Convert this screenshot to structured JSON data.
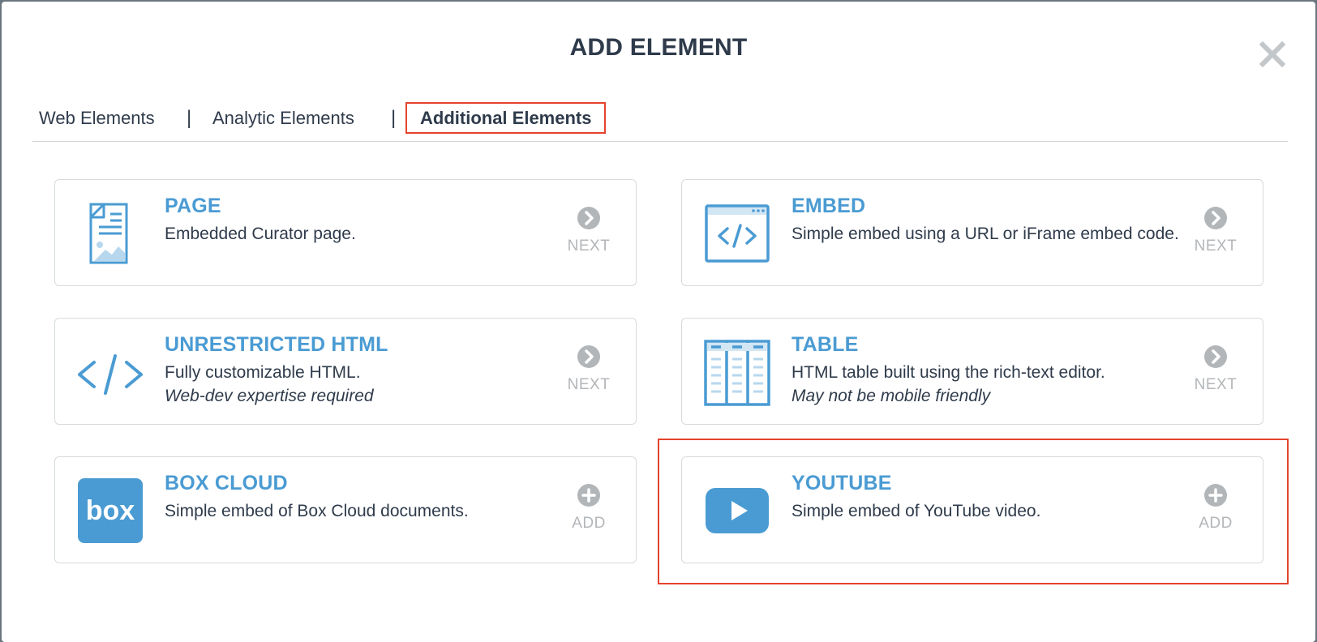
{
  "dialog": {
    "title": "ADD ELEMENT"
  },
  "tabs": [
    {
      "label": "Web Elements",
      "active": false
    },
    {
      "label": "Analytic Elements",
      "active": false
    },
    {
      "label": "Additional Elements",
      "active": true
    }
  ],
  "separator": "|",
  "elements": [
    {
      "name": "PAGE",
      "description": "Embedded Curator page.",
      "note": "",
      "action": "NEXT",
      "icon": "page-icon"
    },
    {
      "name": "EMBED",
      "description": "Simple embed using a URL or iFrame embed code.",
      "note": "",
      "action": "NEXT",
      "icon": "code-window-icon"
    },
    {
      "name": "UNRESTRICTED HTML",
      "description": "Fully customizable HTML.",
      "note": "Web-dev expertise required",
      "action": "NEXT",
      "icon": "code-icon"
    },
    {
      "name": "TABLE",
      "description": "HTML table built using the rich-text editor.",
      "note": "May not be mobile friendly",
      "action": "NEXT",
      "icon": "table-icon"
    },
    {
      "name": "BOX CLOUD",
      "description": "Simple embed of Box Cloud documents.",
      "note": "",
      "action": "ADD",
      "icon": "box-logo-icon",
      "logo_text": "box"
    },
    {
      "name": "YOUTUBE",
      "description": "Simple embed of YouTube video.",
      "note": "",
      "action": "ADD",
      "icon": "youtube-play-icon"
    }
  ],
  "colors": {
    "accent": "#4a9bd3",
    "title": "#2f3b4b",
    "action_gray": "#b3b6b9",
    "highlight": "#e4432d"
  }
}
